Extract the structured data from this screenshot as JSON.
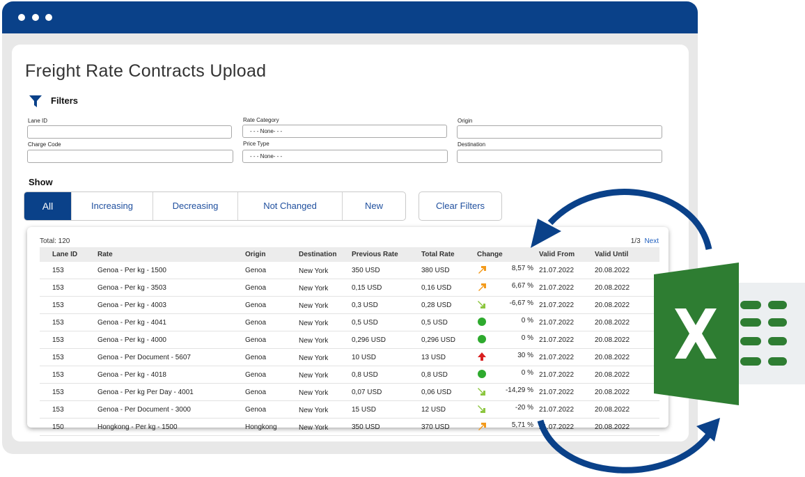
{
  "page": {
    "title": "Freight Rate Contracts Upload"
  },
  "filters": {
    "title": "Filters",
    "lane_id": {
      "label": "Lane  ID",
      "value": ""
    },
    "rate_category": {
      "label": "Rate Category",
      "value": "- - - None- - -"
    },
    "origin": {
      "label": "Origin",
      "value": ""
    },
    "charge_code": {
      "label": "Charge  Code",
      "value": ""
    },
    "price_type": {
      "label": "Price Type",
      "value": "- - - None- - -"
    },
    "destination": {
      "label": "Destination",
      "value": ""
    }
  },
  "show": {
    "label": "Show",
    "options": [
      "All",
      "Increasing",
      "Decreasing",
      "Not Changed",
      "New"
    ],
    "selected": "All",
    "clear_label": "Clear Filters"
  },
  "table": {
    "total_label": "Total: 120",
    "page_label": "1/3",
    "next_label": "Next",
    "columns": [
      "Lane ID",
      "Rate",
      "Origin",
      "Destination",
      "Previous Rate",
      "Total Rate",
      "Change",
      "Valid From",
      "Valid Until"
    ],
    "rows": [
      {
        "lane_id": "153",
        "rate": "Genoa - Per kg - 1500",
        "origin": "Genoa",
        "destination": "New York",
        "previous_rate": "350 USD",
        "total_rate": "380 USD",
        "change_icon": "arrow-up-right-icon",
        "change": "8,57 %",
        "valid_from": "21.07.2022",
        "valid_until": "20.08.2022"
      },
      {
        "lane_id": "153",
        "rate": "Genoa - Per kg - 3503",
        "origin": "Genoa",
        "destination": "New York",
        "previous_rate": "0,15 USD",
        "total_rate": "0,16 USD",
        "change_icon": "arrow-up-right-icon",
        "change": "6,67 %",
        "valid_from": "21.07.2022",
        "valid_until": "20.08.2022"
      },
      {
        "lane_id": "153",
        "rate": "Genoa - Per kg - 4003",
        "origin": "Genoa",
        "destination": "New York",
        "previous_rate": "0,3 USD",
        "total_rate": "0,28 USD",
        "change_icon": "arrow-down-right-icon",
        "change": "-6,67 %",
        "valid_from": "21.07.2022",
        "valid_until": "20.08.2022"
      },
      {
        "lane_id": "153",
        "rate": "Genoa - Per kg - 4041",
        "origin": "Genoa",
        "destination": "New York",
        "previous_rate": "0,5 USD",
        "total_rate": "0,5 USD",
        "change_icon": "green-dot-icon",
        "change": "0 %",
        "valid_from": "21.07.2022",
        "valid_until": "20.08.2022"
      },
      {
        "lane_id": "153",
        "rate": "Genoa - Per kg - 4000",
        "origin": "Genoa",
        "destination": "New York",
        "previous_rate": "0,296 USD",
        "total_rate": "0,296 USD",
        "change_icon": "green-dot-icon",
        "change": "0 %",
        "valid_from": "21.07.2022",
        "valid_until": "20.08.2022"
      },
      {
        "lane_id": "153",
        "rate": "Genoa - Per Document - 5607",
        "origin": "Genoa",
        "destination": "New York",
        "previous_rate": "10 USD",
        "total_rate": "13 USD",
        "change_icon": "arrow-up-icon",
        "change": "30 %",
        "valid_from": "21.07.2022",
        "valid_until": "20.08.2022"
      },
      {
        "lane_id": "153",
        "rate": "Genoa - Per kg - 4018",
        "origin": "Genoa",
        "destination": "New York",
        "previous_rate": "0,8 USD",
        "total_rate": "0,8 USD",
        "change_icon": "green-dot-icon",
        "change": "0 %",
        "valid_from": "21.07.2022",
        "valid_until": "20.08.2022"
      },
      {
        "lane_id": "153",
        "rate": "Genoa - Per kg Per Day - 4001",
        "origin": "Genoa",
        "destination": "New York",
        "previous_rate": "0,07 USD",
        "total_rate": "0,06 USD",
        "change_icon": "arrow-down-right-icon",
        "change": "-14,29 %",
        "valid_from": "21.07.2022",
        "valid_until": "20.08.2022"
      },
      {
        "lane_id": "153",
        "rate": "Genoa - Per Document - 3000",
        "origin": "Genoa",
        "destination": "New York",
        "previous_rate": "15 USD",
        "total_rate": "12 USD",
        "change_icon": "arrow-down-right-icon",
        "change": "-20 %",
        "valid_from": "21.07.2022",
        "valid_until": "20.08.2022"
      },
      {
        "lane_id": "150",
        "rate": "Hongkong - Per kg - 1500",
        "origin": "Hongkong",
        "destination": "New York",
        "previous_rate": "350 USD",
        "total_rate": "370 USD",
        "change_icon": "arrow-up-right-icon",
        "change": "5,71 %",
        "valid_from": "21.07.2022",
        "valid_until": "20.08.2022"
      }
    ]
  },
  "colors": {
    "brand_blue": "#0a4189",
    "link_blue": "#1f4f9e",
    "increase_orange": "#f39a1b",
    "decrease_green": "#8cc63f",
    "unchanged_green": "#2eaa2e",
    "strong_increase_red": "#d92020",
    "excel_green": "#2e7d32"
  },
  "decor": {
    "excel_icon": "excel-logo-icon",
    "sync_arrows": "sync-arrows-icon"
  }
}
